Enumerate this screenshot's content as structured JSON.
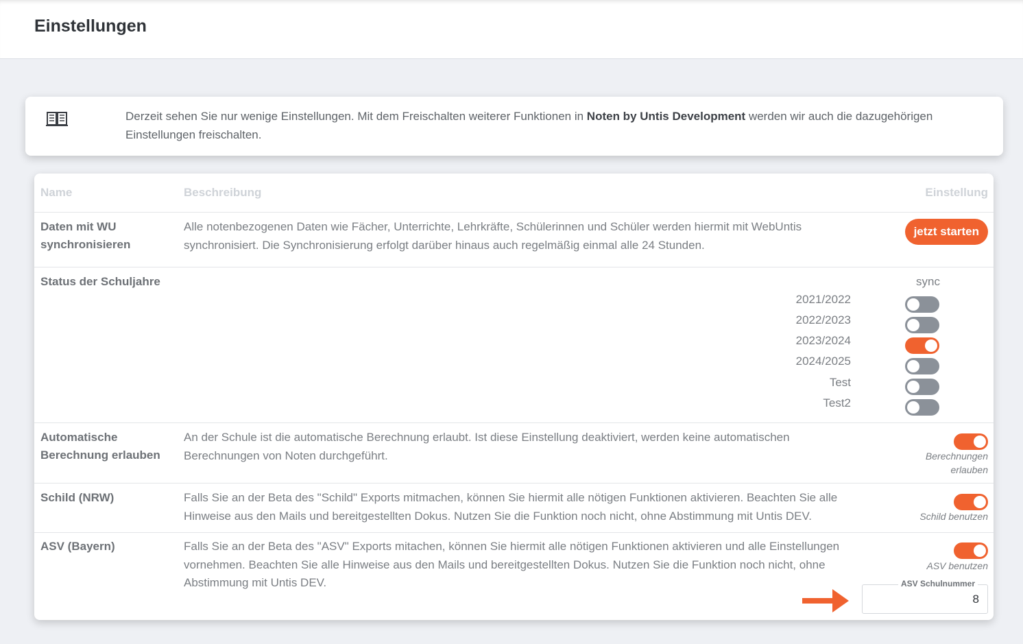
{
  "header": {
    "title": "Einstellungen"
  },
  "info": {
    "icon": "book-icon",
    "text_before": "Derzeit sehen Sie nur wenige Einstellungen. Mit dem Freischalten weiterer Funktionen in ",
    "text_bold": "Noten by Untis Development",
    "text_after": " werden wir auch die dazugehörigen Einstellungen freischalten."
  },
  "table": {
    "headers": {
      "name": "Name",
      "description": "Beschreibung",
      "setting": "Einstellung"
    },
    "sync_row": {
      "name": "Daten mit WU synchronisieren",
      "description": "Alle notenbezogenen Daten wie Fächer, Unterrichte, Lehrkräfte, Schülerinnen und Schüler werden hiermit mit WebUntis synchronisiert. Die Synchronisierung erfolgt darüber hinaus auch regelmäßig einmal alle 24 Stunden.",
      "button": "jetzt starten"
    },
    "years_row": {
      "name": "Status der Schuljahre",
      "column": "sync",
      "years": [
        {
          "label": "2021/2022",
          "on": false
        },
        {
          "label": "2022/2023",
          "on": false
        },
        {
          "label": "2023/2024",
          "on": true
        },
        {
          "label": "2024/2025",
          "on": false
        },
        {
          "label": "Test",
          "on": false
        },
        {
          "label": "Test2",
          "on": false
        }
      ]
    },
    "auto_row": {
      "name": "Automatische Berechnung erlauben",
      "description": "An der Schule ist die automatische Berechnung erlaubt. Ist diese Einstellung deaktiviert, werden keine automatischen Berechnungen von Noten durchgeführt.",
      "toggle_label": "Berechnungen erlauben",
      "on": true
    },
    "schild_row": {
      "name": "Schild (NRW)",
      "description": "Falls Sie an der Beta des \"Schild\" Exports mitmachen, können Sie hiermit alle nötigen Funktionen aktivieren. Beachten Sie alle Hinweise aus den Mails und bereitgestellten Dokus. Nutzen Sie die Funktion noch nicht, ohne Abstimmung mit Untis DEV.",
      "toggle_label": "Schild benutzen",
      "on": true
    },
    "asv_row": {
      "name": "ASV (Bayern)",
      "description": "Falls Sie an der Beta des \"ASV\" Exports mitachen, können Sie hiermit alle nötigen Funktionen aktivieren und alle Einstellungen vornehmen. Beachten Sie alle Hinweise aus den Mails und bereitgestellten Dokus. Nutzen Sie die Funktion noch nicht, ohne Abstimmung mit Untis DEV.",
      "toggle_label": "ASV benutzen",
      "on": true,
      "field_label": "ASV Schulnummer",
      "field_value": "8"
    }
  },
  "colors": {
    "accent": "#f0622f",
    "toggle_off": "#8b9199"
  }
}
